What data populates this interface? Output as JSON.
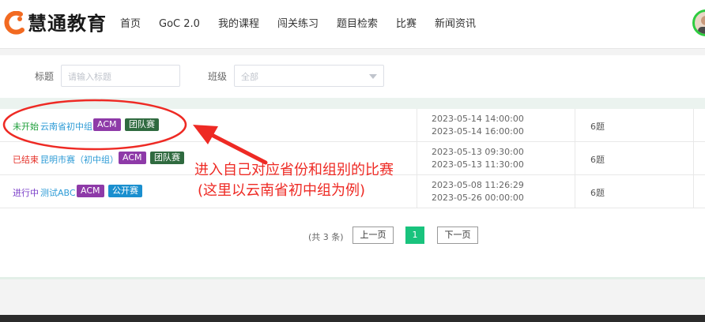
{
  "header": {
    "logo_text": "慧通教育",
    "logo_color": "#f26a21",
    "nav": [
      "首页",
      "GoC 2.0",
      "我的课程",
      "闯关练习",
      "题目检索",
      "比赛",
      "新闻资讯"
    ]
  },
  "filter": {
    "title_label": "标题",
    "title_placeholder": "请输入标题",
    "class_label": "班级",
    "class_value": "全部"
  },
  "contests": [
    {
      "status": "未开始",
      "status_color": "#1e9e3a",
      "title": "云南省初中组",
      "tags": [
        "ACM",
        "团队赛"
      ],
      "start": "2023-05-14 14:00:00",
      "end": "2023-05-14 16:00:00",
      "problems": "6题"
    },
    {
      "status": "已结束",
      "status_color": "#e5332b",
      "title": "昆明市赛（初中组）",
      "tags": [
        "ACM",
        "团队赛"
      ],
      "start": "2023-05-13 09:30:00",
      "end": "2023-05-13 11:30:00",
      "problems": "6题"
    },
    {
      "status": "进行中",
      "status_color": "#7a3ec8",
      "title": "测试ABC",
      "tags": [
        "ACM",
        "公开赛"
      ],
      "start": "2023-05-08 11:26:29",
      "end": "2023-05-26 00:00:00",
      "problems": "6题"
    }
  ],
  "pagination": {
    "total": "(共 3 条)",
    "prev": "上一页",
    "current": "1",
    "next": "下一页"
  },
  "annotation": {
    "line1": "进入自己对应省份和组别的比赛",
    "line2": "(这里以云南省初中组为例)",
    "color": "#ee2a24"
  }
}
